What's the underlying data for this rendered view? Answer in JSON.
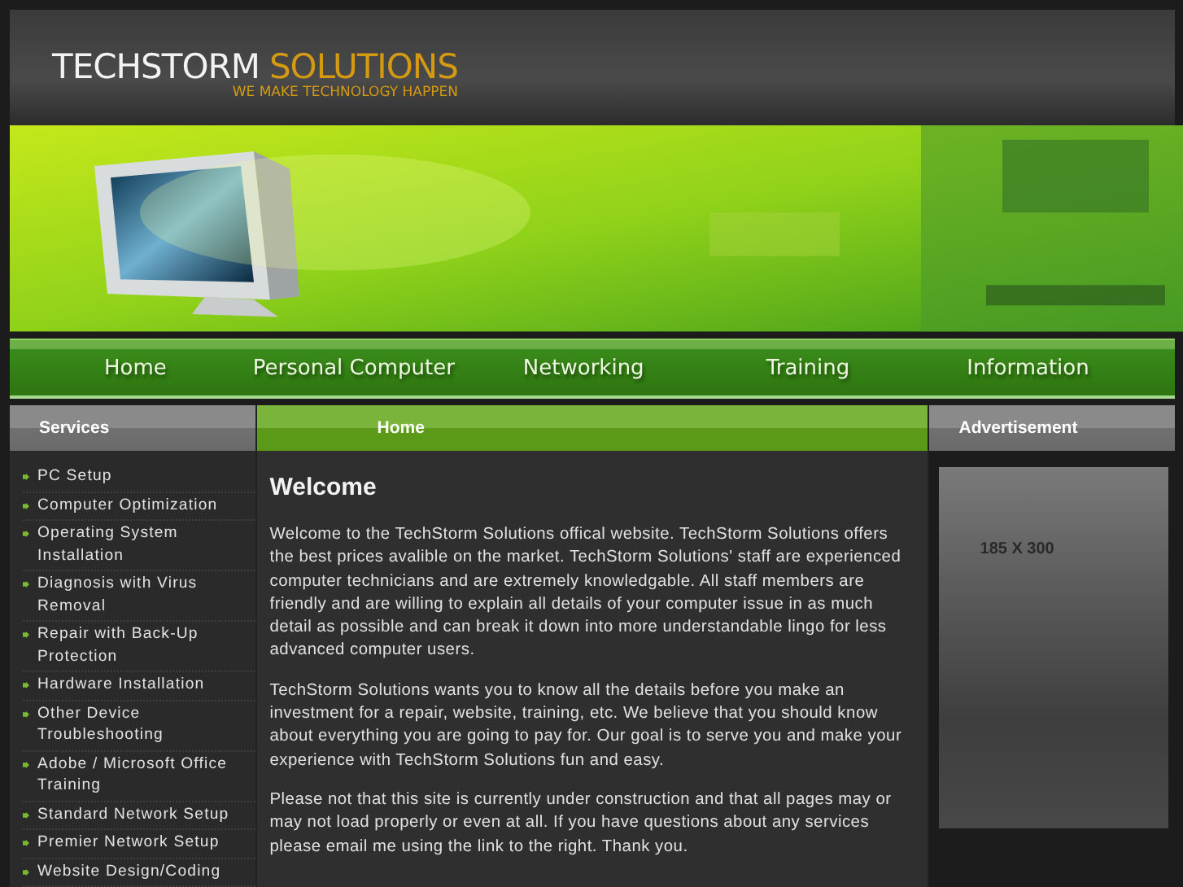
{
  "header": {
    "logo_primary": "TECHSTORM",
    "logo_secondary": "SOLUTIONS",
    "tagline": "WE MAKE TECHNOLOGY HAPPEN"
  },
  "nav": [
    {
      "label": "Home"
    },
    {
      "label": "Personal Computer"
    },
    {
      "label": "Networking"
    },
    {
      "label": "Training"
    },
    {
      "label": "Information"
    }
  ],
  "columns": {
    "left": "Services",
    "center": "Home",
    "right": "Advertisement"
  },
  "services": [
    "PC Setup",
    "Computer Optimization",
    "Operating System Installation",
    "Diagnosis with Virus Removal",
    "Repair with Back-Up Protection",
    "Hardware Installation",
    "Other Device Troubleshooting",
    "Adobe / Microsoft Office Training",
    "Standard Network Setup",
    "Premier Network Setup",
    "Website Design/Coding"
  ],
  "main": {
    "heading": "Welcome",
    "paragraphs": [
      "Welcome to the TechStorm Solutions offical website. TechStorm Solutions offers the best prices avalible on the market. TechStorm Solutions' staff are experienced computer technicians and are extremely knowledgable. All staff members are friendly and are willing to explain all details of your computer issue in as much detail as possible and can break it down into more understandable lingo for less advanced computer users.",
      "TechStorm Solutions wants you to know all the details before you make an investment for a repair, website, training, etc. We believe that you should know about everything you are going to pay for. Our goal is to serve you and make your experience with TechStorm Solutions fun and easy.",
      "Please not that this site is currently under construction and that all pages may or may not load properly or even at all. If you have questions about any services please email me using the link to the right. Thank you."
    ]
  },
  "advertisement": {
    "size_label": "185 X 300"
  }
}
